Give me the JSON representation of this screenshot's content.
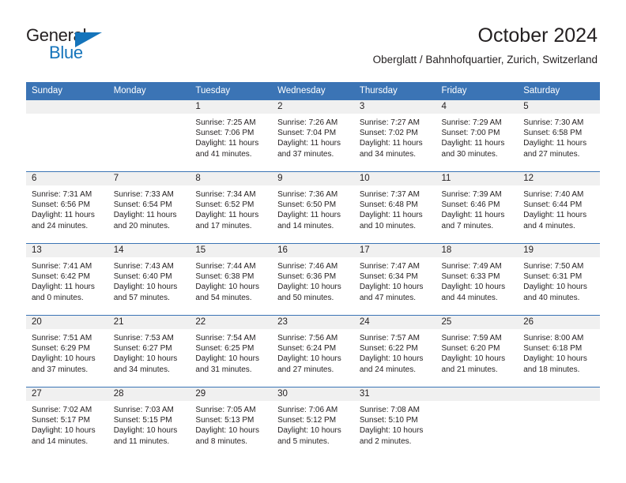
{
  "brand": {
    "line1": "General",
    "line2": "Blue",
    "triangle_color": "#1574bb",
    "text_color": "#231f20"
  },
  "header": {
    "title": "October 2024",
    "subtitle": "Oberglatt / Bahnhofquartier, Zurich, Switzerland"
  },
  "theme": {
    "header_blue": "#3b74b5",
    "daynum_band": "#f0f0f0",
    "text": "#231f20"
  },
  "calendar": {
    "weekday_headers": [
      "Sunday",
      "Monday",
      "Tuesday",
      "Wednesday",
      "Thursday",
      "Friday",
      "Saturday"
    ],
    "weeks": [
      [
        {
          "day": "",
          "blank": true
        },
        {
          "day": "",
          "blank": true
        },
        {
          "day": "1",
          "sunrise": "Sunrise: 7:25 AM",
          "sunset": "Sunset: 7:06 PM",
          "daylight1": "Daylight: 11 hours",
          "daylight2": "and 41 minutes."
        },
        {
          "day": "2",
          "sunrise": "Sunrise: 7:26 AM",
          "sunset": "Sunset: 7:04 PM",
          "daylight1": "Daylight: 11 hours",
          "daylight2": "and 37 minutes."
        },
        {
          "day": "3",
          "sunrise": "Sunrise: 7:27 AM",
          "sunset": "Sunset: 7:02 PM",
          "daylight1": "Daylight: 11 hours",
          "daylight2": "and 34 minutes."
        },
        {
          "day": "4",
          "sunrise": "Sunrise: 7:29 AM",
          "sunset": "Sunset: 7:00 PM",
          "daylight1": "Daylight: 11 hours",
          "daylight2": "and 30 minutes."
        },
        {
          "day": "5",
          "sunrise": "Sunrise: 7:30 AM",
          "sunset": "Sunset: 6:58 PM",
          "daylight1": "Daylight: 11 hours",
          "daylight2": "and 27 minutes."
        }
      ],
      [
        {
          "day": "6",
          "sunrise": "Sunrise: 7:31 AM",
          "sunset": "Sunset: 6:56 PM",
          "daylight1": "Daylight: 11 hours",
          "daylight2": "and 24 minutes."
        },
        {
          "day": "7",
          "sunrise": "Sunrise: 7:33 AM",
          "sunset": "Sunset: 6:54 PM",
          "daylight1": "Daylight: 11 hours",
          "daylight2": "and 20 minutes."
        },
        {
          "day": "8",
          "sunrise": "Sunrise: 7:34 AM",
          "sunset": "Sunset: 6:52 PM",
          "daylight1": "Daylight: 11 hours",
          "daylight2": "and 17 minutes."
        },
        {
          "day": "9",
          "sunrise": "Sunrise: 7:36 AM",
          "sunset": "Sunset: 6:50 PM",
          "daylight1": "Daylight: 11 hours",
          "daylight2": "and 14 minutes."
        },
        {
          "day": "10",
          "sunrise": "Sunrise: 7:37 AM",
          "sunset": "Sunset: 6:48 PM",
          "daylight1": "Daylight: 11 hours",
          "daylight2": "and 10 minutes."
        },
        {
          "day": "11",
          "sunrise": "Sunrise: 7:39 AM",
          "sunset": "Sunset: 6:46 PM",
          "daylight1": "Daylight: 11 hours",
          "daylight2": "and 7 minutes."
        },
        {
          "day": "12",
          "sunrise": "Sunrise: 7:40 AM",
          "sunset": "Sunset: 6:44 PM",
          "daylight1": "Daylight: 11 hours",
          "daylight2": "and 4 minutes."
        }
      ],
      [
        {
          "day": "13",
          "sunrise": "Sunrise: 7:41 AM",
          "sunset": "Sunset: 6:42 PM",
          "daylight1": "Daylight: 11 hours",
          "daylight2": "and 0 minutes."
        },
        {
          "day": "14",
          "sunrise": "Sunrise: 7:43 AM",
          "sunset": "Sunset: 6:40 PM",
          "daylight1": "Daylight: 10 hours",
          "daylight2": "and 57 minutes."
        },
        {
          "day": "15",
          "sunrise": "Sunrise: 7:44 AM",
          "sunset": "Sunset: 6:38 PM",
          "daylight1": "Daylight: 10 hours",
          "daylight2": "and 54 minutes."
        },
        {
          "day": "16",
          "sunrise": "Sunrise: 7:46 AM",
          "sunset": "Sunset: 6:36 PM",
          "daylight1": "Daylight: 10 hours",
          "daylight2": "and 50 minutes."
        },
        {
          "day": "17",
          "sunrise": "Sunrise: 7:47 AM",
          "sunset": "Sunset: 6:34 PM",
          "daylight1": "Daylight: 10 hours",
          "daylight2": "and 47 minutes."
        },
        {
          "day": "18",
          "sunrise": "Sunrise: 7:49 AM",
          "sunset": "Sunset: 6:33 PM",
          "daylight1": "Daylight: 10 hours",
          "daylight2": "and 44 minutes."
        },
        {
          "day": "19",
          "sunrise": "Sunrise: 7:50 AM",
          "sunset": "Sunset: 6:31 PM",
          "daylight1": "Daylight: 10 hours",
          "daylight2": "and 40 minutes."
        }
      ],
      [
        {
          "day": "20",
          "sunrise": "Sunrise: 7:51 AM",
          "sunset": "Sunset: 6:29 PM",
          "daylight1": "Daylight: 10 hours",
          "daylight2": "and 37 minutes."
        },
        {
          "day": "21",
          "sunrise": "Sunrise: 7:53 AM",
          "sunset": "Sunset: 6:27 PM",
          "daylight1": "Daylight: 10 hours",
          "daylight2": "and 34 minutes."
        },
        {
          "day": "22",
          "sunrise": "Sunrise: 7:54 AM",
          "sunset": "Sunset: 6:25 PM",
          "daylight1": "Daylight: 10 hours",
          "daylight2": "and 31 minutes."
        },
        {
          "day": "23",
          "sunrise": "Sunrise: 7:56 AM",
          "sunset": "Sunset: 6:24 PM",
          "daylight1": "Daylight: 10 hours",
          "daylight2": "and 27 minutes."
        },
        {
          "day": "24",
          "sunrise": "Sunrise: 7:57 AM",
          "sunset": "Sunset: 6:22 PM",
          "daylight1": "Daylight: 10 hours",
          "daylight2": "and 24 minutes."
        },
        {
          "day": "25",
          "sunrise": "Sunrise: 7:59 AM",
          "sunset": "Sunset: 6:20 PM",
          "daylight1": "Daylight: 10 hours",
          "daylight2": "and 21 minutes."
        },
        {
          "day": "26",
          "sunrise": "Sunrise: 8:00 AM",
          "sunset": "Sunset: 6:18 PM",
          "daylight1": "Daylight: 10 hours",
          "daylight2": "and 18 minutes."
        }
      ],
      [
        {
          "day": "27",
          "sunrise": "Sunrise: 7:02 AM",
          "sunset": "Sunset: 5:17 PM",
          "daylight1": "Daylight: 10 hours",
          "daylight2": "and 14 minutes."
        },
        {
          "day": "28",
          "sunrise": "Sunrise: 7:03 AM",
          "sunset": "Sunset: 5:15 PM",
          "daylight1": "Daylight: 10 hours",
          "daylight2": "and 11 minutes."
        },
        {
          "day": "29",
          "sunrise": "Sunrise: 7:05 AM",
          "sunset": "Sunset: 5:13 PM",
          "daylight1": "Daylight: 10 hours",
          "daylight2": "and 8 minutes."
        },
        {
          "day": "30",
          "sunrise": "Sunrise: 7:06 AM",
          "sunset": "Sunset: 5:12 PM",
          "daylight1": "Daylight: 10 hours",
          "daylight2": "and 5 minutes."
        },
        {
          "day": "31",
          "sunrise": "Sunrise: 7:08 AM",
          "sunset": "Sunset: 5:10 PM",
          "daylight1": "Daylight: 10 hours",
          "daylight2": "and 2 minutes."
        },
        {
          "day": "",
          "blank": true
        },
        {
          "day": "",
          "blank": true
        }
      ]
    ]
  }
}
